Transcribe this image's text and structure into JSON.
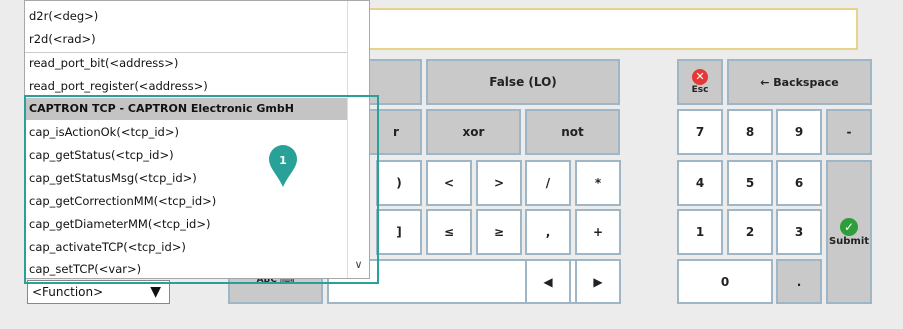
{
  "expression": {
    "value": ""
  },
  "dropdown": {
    "items": [
      {
        "label": "d2r(<deg>)",
        "header": false
      },
      {
        "label": "r2d(<rad>)",
        "header": false
      },
      {
        "label": "read_port_bit(<address>)",
        "header": false
      },
      {
        "label": "read_port_register(<address>)",
        "header": false
      },
      {
        "label": "CAPTRON TCP - CAPTRON Electronic GmbH",
        "header": true
      },
      {
        "label": "cap_isActionOk(<tcp_id>)",
        "header": false
      },
      {
        "label": "cap_getStatus(<tcp_id>)",
        "header": false
      },
      {
        "label": "cap_getStatusMsg(<tcp_id>)",
        "header": false
      },
      {
        "label": "cap_getCorrectionMM(<tcp_id>)",
        "header": false
      },
      {
        "label": "cap_getDiameterMM(<tcp_id>)",
        "header": false
      },
      {
        "label": "cap_activateTCP(<tcp_id>)",
        "header": false
      },
      {
        "label": "cap_setTCP(<var>)",
        "header": false
      }
    ],
    "scroll_down_glyph": "∨"
  },
  "function_select": {
    "selected": "<Function>",
    "arrow": "▼"
  },
  "marker": {
    "number": "1",
    "color": "#2aa198"
  },
  "keypad": {
    "false_lo": "False (LO)",
    "xor": "xor",
    "not": "not",
    "or_partial": "r",
    "close_paren": ")",
    "lt": "<",
    "gt": ">",
    "divide": "/",
    "multiply": "*",
    "close_bracket": "]",
    "le": "≤",
    "ge": "≥",
    "comma": ",",
    "plus": "+",
    "left_arrow": "◀",
    "right_arrow": "▶",
    "abc": "ABC"
  },
  "numpad": {
    "esc": "Esc",
    "backspace": "← Backspace",
    "d7": "7",
    "d8": "8",
    "d9": "9",
    "minus": "-",
    "d4": "4",
    "d5": "5",
    "d6": "6",
    "d1": "1",
    "d2": "2",
    "d3": "3",
    "d0": "0",
    "dot": ".",
    "submit": "Submit"
  },
  "colors": {
    "accent_teal": "#2aa198",
    "button_border": "#9fb6c7",
    "submit_green": "#2e9e3a",
    "esc_red": "#e53935"
  }
}
